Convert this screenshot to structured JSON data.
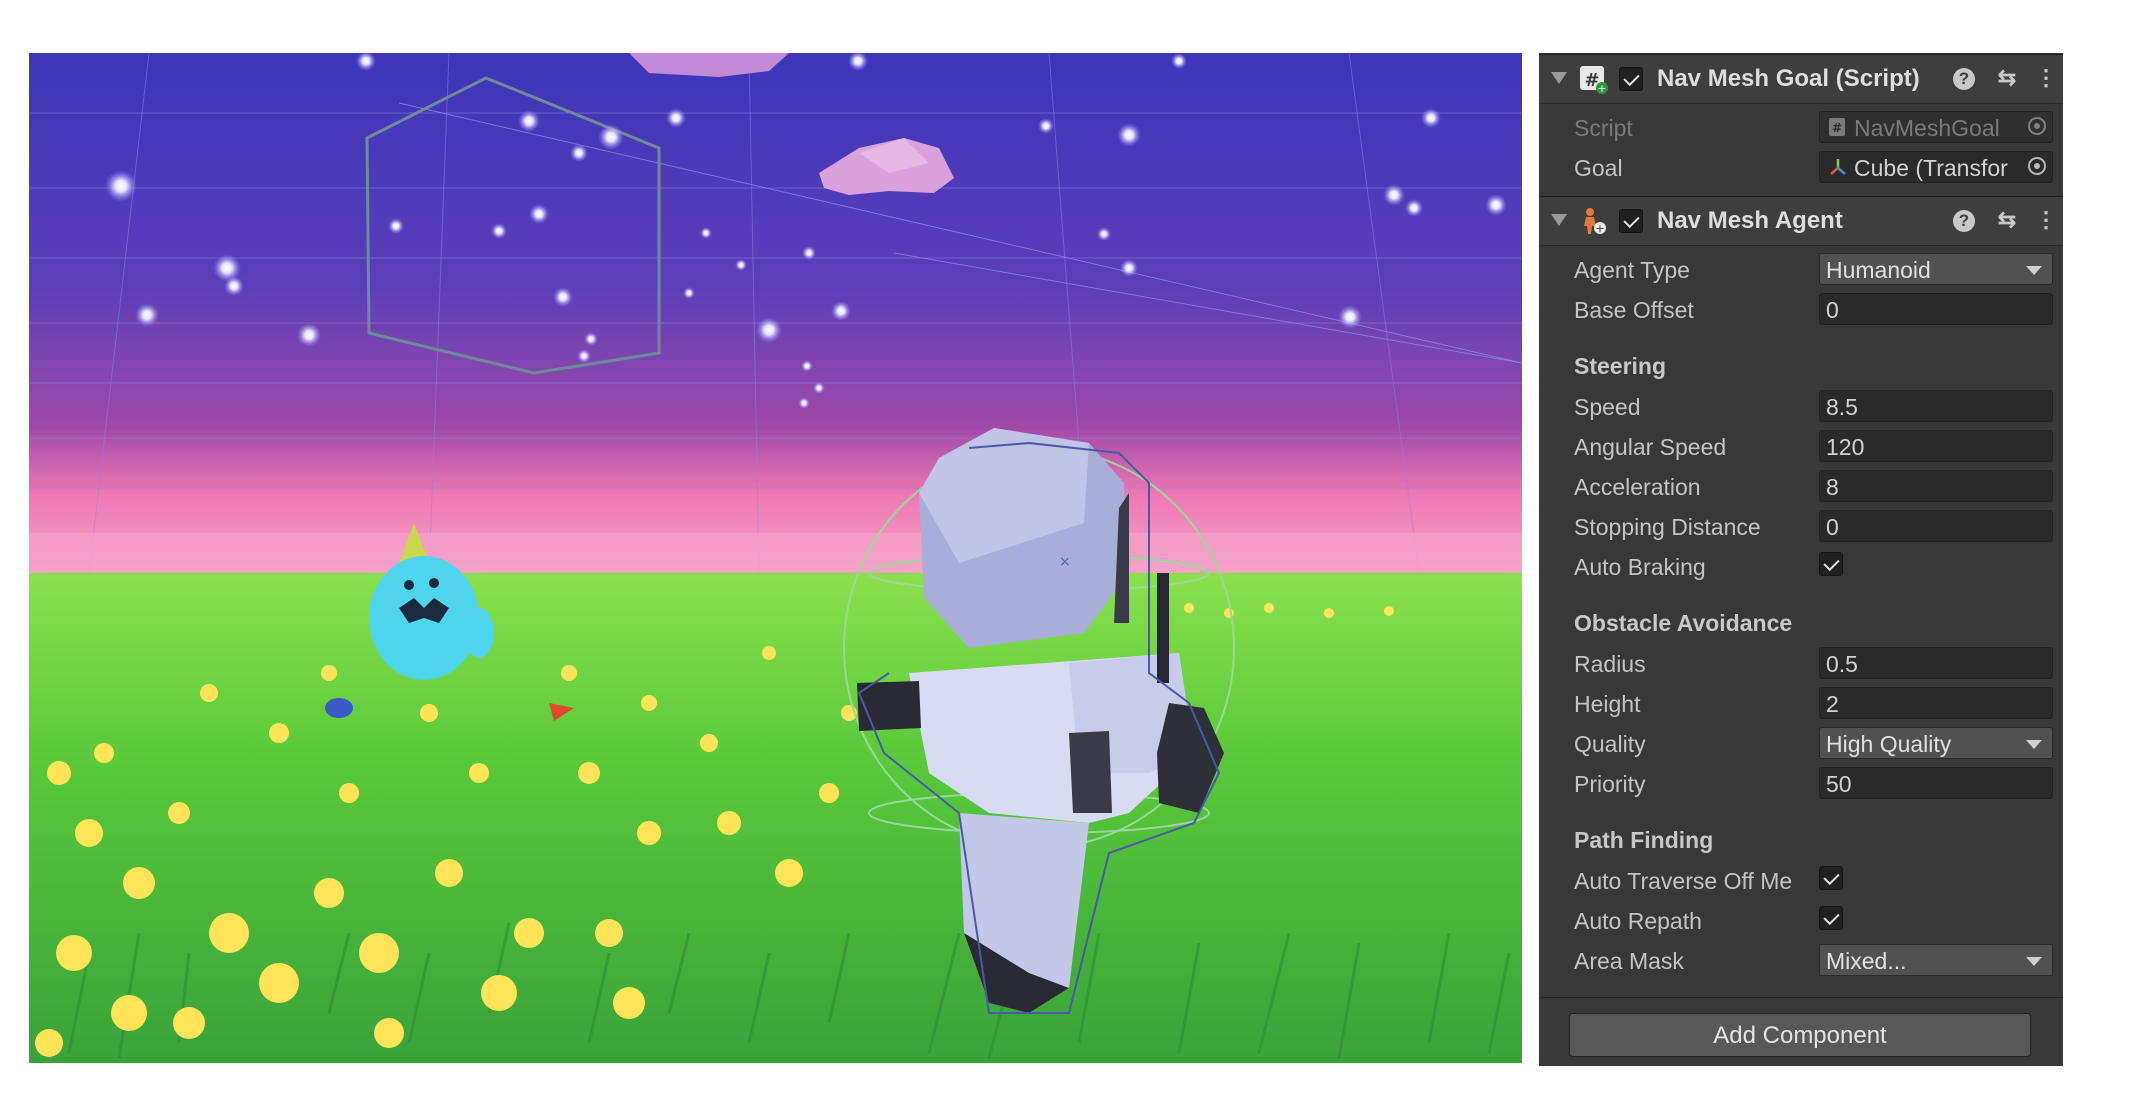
{
  "nav_mesh_goal": {
    "title": "Nav Mesh Goal (Script)",
    "script_label": "Script",
    "script_value": "NavMeshGoal",
    "goal_label": "Goal",
    "goal_value": "Cube (Transfor"
  },
  "nav_mesh_agent": {
    "title": "Nav Mesh Agent",
    "agent_type_label": "Agent Type",
    "agent_type_value": "Humanoid",
    "base_offset_label": "Base Offset",
    "base_offset_value": "0",
    "steering": {
      "heading": "Steering",
      "speed_label": "Speed",
      "speed_value": "8.5",
      "angular_speed_label": "Angular Speed",
      "angular_speed_value": "120",
      "acceleration_label": "Acceleration",
      "acceleration_value": "8",
      "stopping_distance_label": "Stopping Distance",
      "stopping_distance_value": "0",
      "auto_braking_label": "Auto Braking",
      "auto_braking_checked": true
    },
    "obstacle_avoidance": {
      "heading": "Obstacle Avoidance",
      "radius_label": "Radius",
      "radius_value": "0.5",
      "height_label": "Height",
      "height_value": "2",
      "quality_label": "Quality",
      "quality_value": "High Quality",
      "priority_label": "Priority",
      "priority_value": "50"
    },
    "path_finding": {
      "heading": "Path Finding",
      "auto_traverse_label": "Auto Traverse Off Me",
      "auto_traverse_checked": true,
      "auto_repath_label": "Auto Repath",
      "auto_repath_checked": true,
      "area_mask_label": "Area Mask",
      "area_mask_value": "Mixed..."
    }
  },
  "add_component_label": "Add Component",
  "icons": {
    "foldout": "triangle-down-icon",
    "script_component": "csharp-script-icon",
    "agent_component": "nav-agent-icon",
    "help": "help-icon",
    "presets": "presets-icon",
    "menu": "kebab-menu-icon",
    "object_picker": "object-picker-icon",
    "transform": "transform-icon"
  },
  "colors": {
    "inspector_bg": "#383838",
    "header_bg": "#3e3e3e",
    "field_bg": "#2a2a2a",
    "sky_top": "#4a3fc0",
    "horizon": "#e07ab8",
    "grass": "#5fc83c"
  }
}
